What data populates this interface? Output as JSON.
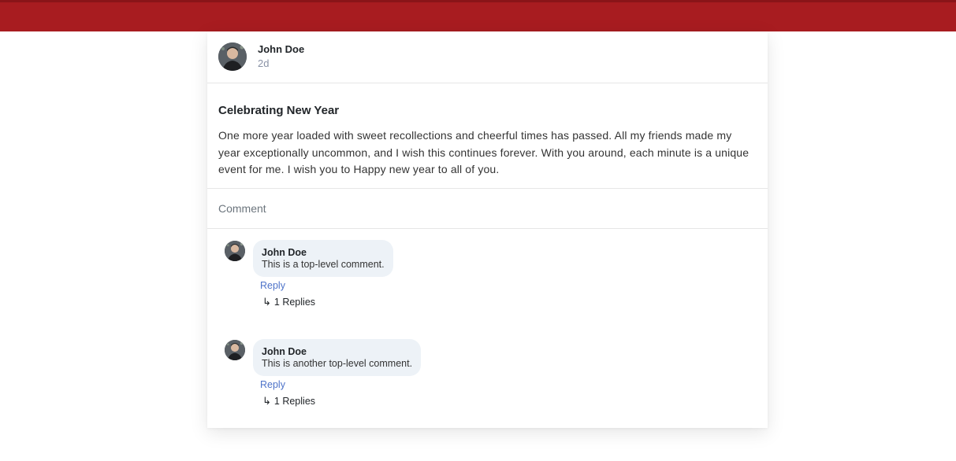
{
  "post": {
    "author": "John Doe",
    "time": "2d",
    "title": "Celebrating New Year",
    "body": "One more year loaded with sweet recollections and cheerful times has passed. All my friends made my year exceptionally uncommon, and I wish this continues forever. With you around, each minute is a unique event for me. I wish you to Happy new year to all of you."
  },
  "comment_action": "Comment",
  "comments": [
    {
      "author": "John Doe",
      "text": "This is a top-level comment.",
      "reply_label": "Reply",
      "replies_label": "1 Replies"
    },
    {
      "author": "John Doe",
      "text": "This is another top-level comment.",
      "reply_label": "Reply",
      "replies_label": "1 Replies"
    }
  ],
  "icons": {
    "reply_arrow": "reply-arrow-icon"
  },
  "colors": {
    "topbar": "#a81c20",
    "link": "#4e73c9",
    "bubble": "#edf2f7"
  }
}
